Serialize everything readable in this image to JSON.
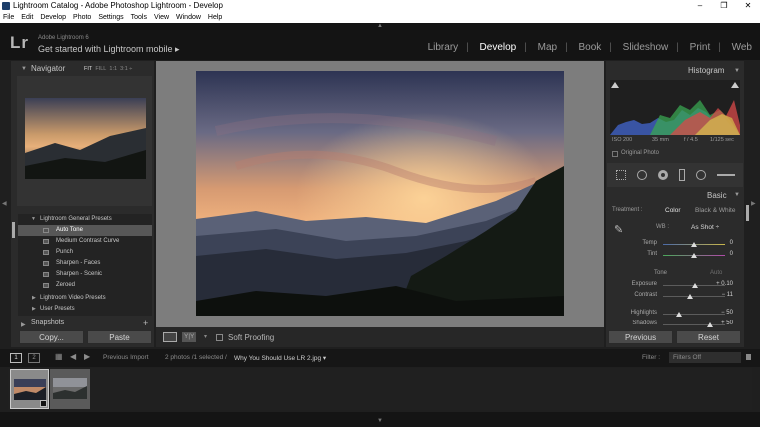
{
  "window": {
    "title": "Lightroom Catalog - Adobe Photoshop Lightroom - Develop",
    "controls": [
      "–",
      "❐",
      "✕"
    ]
  },
  "menu": [
    "File",
    "Edit",
    "Develop",
    "Photo",
    "Settings",
    "Tools",
    "View",
    "Window",
    "Help"
  ],
  "identity": {
    "logo": "Lr",
    "version": "Adobe Lightroom 6",
    "prompt": "Get started with Lightroom mobile ▸"
  },
  "modules": {
    "items": [
      "Library",
      "Develop",
      "Map",
      "Book",
      "Slideshow",
      "Print",
      "Web"
    ],
    "active": "Develop"
  },
  "navigator": {
    "title": "Navigator",
    "zoom": [
      "FIT",
      "FILL",
      "1:1",
      "3:1 ÷"
    ]
  },
  "presets": {
    "groups": {
      "general": "Lightroom General Presets",
      "video": "Lightroom Video Presets",
      "user": "User Presets"
    },
    "items": [
      "Auto Tone",
      "Medium Contrast Curve",
      "Punch",
      "Sharpen - Faces",
      "Sharpen - Scenic",
      "Zeroed"
    ],
    "selected": "Auto Tone"
  },
  "snapshots": {
    "title": "Snapshots",
    "add": "+"
  },
  "left_buttons": {
    "copy": "Copy...",
    "paste": "Paste"
  },
  "toolbar": {
    "soft_proofing": "Soft Proofing",
    "view_yy": "Y|Y"
  },
  "histogram": {
    "title": "Histogram",
    "info": {
      "iso": "ISO 200",
      "focal": "35 mm",
      "aperture": "f / 4.5",
      "shutter": "1/125 sec"
    },
    "original_photo": "Original Photo"
  },
  "basic": {
    "title": "Basic",
    "treatment": {
      "label": "Treatment :",
      "color": "Color",
      "bw": "Black & White"
    },
    "wb": {
      "label": "WB :",
      "value": "As Shot ÷"
    },
    "temp": {
      "label": "Temp",
      "value": "0",
      "position": 0.5
    },
    "tint": {
      "label": "Tint",
      "value": "0",
      "position": 0.5
    },
    "tone": {
      "label": "Tone",
      "auto": "Auto"
    },
    "exposure": {
      "label": "Exposure",
      "value": "+ 0.10",
      "position": 0.51
    },
    "contrast": {
      "label": "Contrast",
      "value": "− 11",
      "position": 0.44
    },
    "highlights": {
      "label": "Highlights",
      "value": "− 50",
      "position": 0.25
    },
    "shadows": {
      "label": "Shadows",
      "value": "+ 50",
      "position": 0.75
    }
  },
  "right_buttons": {
    "previous": "Previous",
    "reset": "Reset"
  },
  "filmbar": {
    "page1": "1",
    "page2": "2",
    "source": "Previous Import",
    "count": "2 photos /1 selected /",
    "filename": "Why You Should Use LR 2.jpg ▾",
    "filter_label": "Filter :",
    "filter_value": "Filters Off"
  },
  "colors": {
    "active_module": "#ffffff",
    "panel_bg": "#2b2b2b",
    "center_bg": "#7d7d7d",
    "selected_preset": "#575757"
  }
}
